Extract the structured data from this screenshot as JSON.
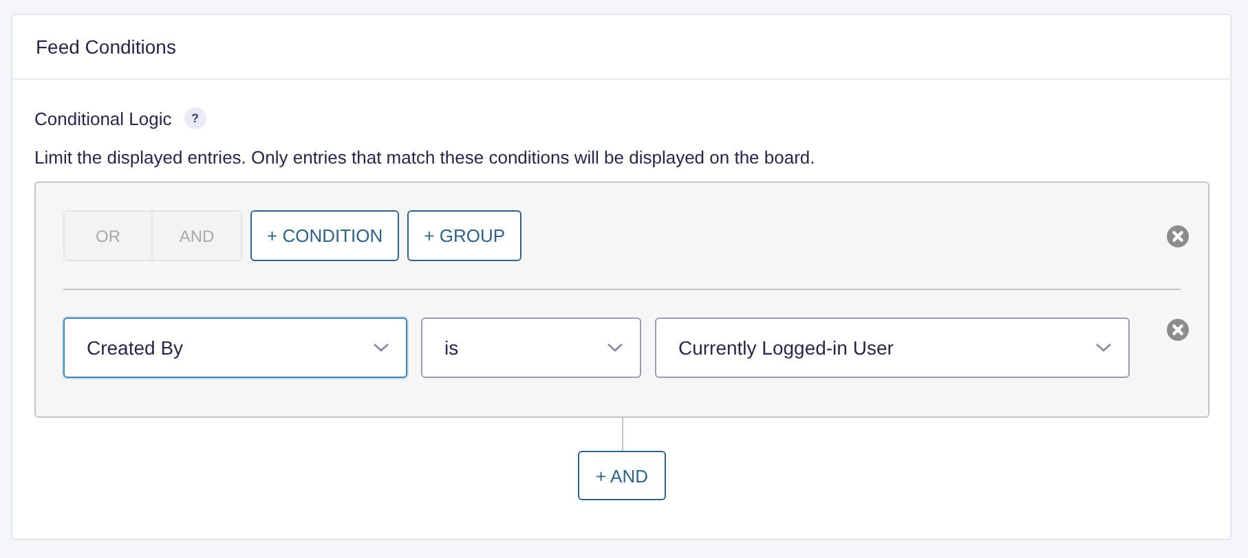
{
  "panel": {
    "title": "Feed Conditions"
  },
  "field": {
    "label": "Conditional Logic",
    "help": "?",
    "description": "Limit the displayed entries. Only entries that match these conditions will be displayed on the board."
  },
  "toggle": [
    {
      "label": "OR",
      "disabled": true
    },
    {
      "label": "AND",
      "disabled": true
    }
  ],
  "actions": [
    "+ CONDITION",
    "+ GROUP"
  ],
  "conditions": [
    {
      "field": "Created By",
      "focused": true,
      "operator": "is",
      "value": "Currently Logged-in User"
    }
  ],
  "add_button": "+ AND"
}
